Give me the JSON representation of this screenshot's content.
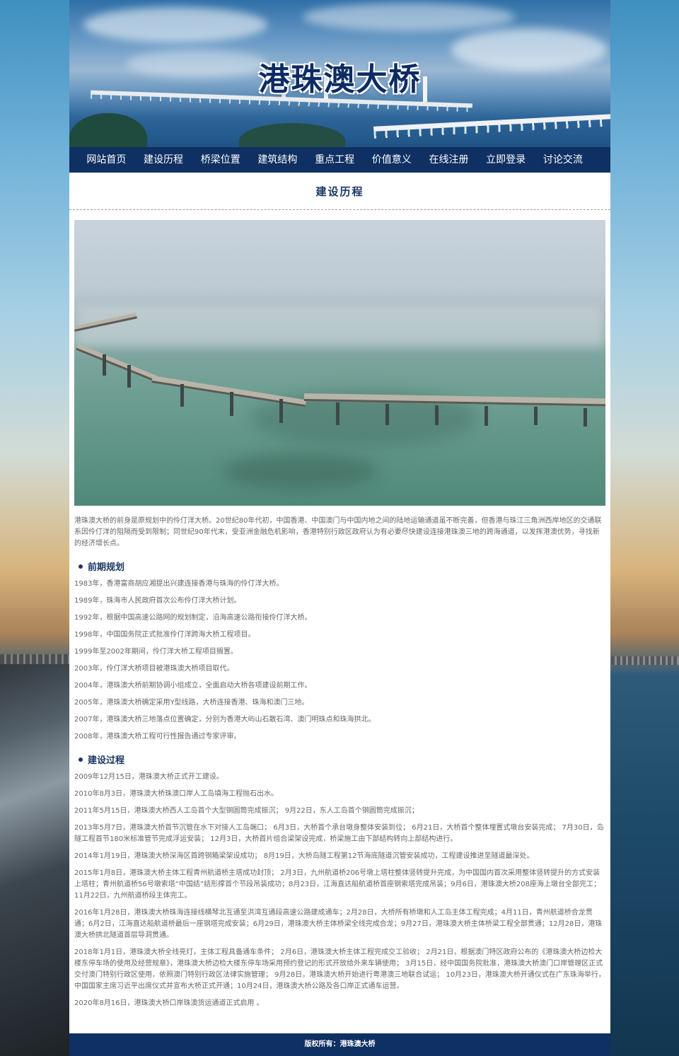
{
  "banner": {
    "title": "港珠澳大桥"
  },
  "nav": {
    "items": [
      "网站首页",
      "建设历程",
      "桥梁位置",
      "建筑结构",
      "重点工程",
      "价值意义",
      "在线注册",
      "立即登录",
      "讨论交流"
    ]
  },
  "section": {
    "title": "建设历程"
  },
  "intro": "港珠澳大桥的前身是原规划中的伶仃洋大桥。20世纪80年代初，中国香港、中国澳门与中国内地之间的陆地运输通道虽不断完善，但香港与珠江三角洲西岸地区的交通联系因伶仃洋的阻隔而受到限制；同世纪90年代末，受亚洲金融危机影响，香港特别行政区政府认为有必要尽快建设连接港珠澳三地的跨海通道，以发挥港澳优势，寻找新的经济增长点。",
  "phases": [
    {
      "heading": "前期规划",
      "events": [
        "1983年，香港富商胡应湘提出兴建连接香港与珠海的伶仃洋大桥。",
        "1989年，珠海市人民政府首次公布伶仃洋大桥计划。",
        "1992年，根据中国高速公路网的规划制定，沿海高速公路衔接伶仃洋大桥。",
        "1998年，中国国务院正式批准伶仃洋跨海大桥工程项目。",
        "1999年至2002年期间，伶仃洋大桥工程项目搁置。",
        "2003年，伶仃洋大桥项目被港珠澳大桥项目取代。",
        "2004年，港珠澳大桥前期协调小组成立，全面启动大桥各项建设前期工作。",
        "2005年，港珠澳大桥确定采用Y型线路，大桥连接香港、珠海和澳门三地。",
        "2007年，港珠澳大桥三地落点位置确定，分别为香港大屿山石散石湾、澳门明珠点和珠海拱北。",
        "2008年，港珠澳大桥工程可行性报告通过专家评审。"
      ]
    },
    {
      "heading": "建设过程",
      "events": [
        "2009年12月15日，港珠澳大桥正式开工建设。",
        "2010年8月3日，港珠澳大桥珠澳口岸人工岛填海工程抛石出水。",
        "2011年5月15日，港珠澳大桥西人工岛首个大型钢圆筒完成振沉； 9月22日，东人工岛首个钢圆筒完成振沉；",
        "2013年5月7日，港珠澳大桥首节沉管在水下对接人工岛端口； 6月3日，大桥首个承台墩身整体安装到位； 6月21日，大桥首个整体埋置式墩台安装完成； 7月30日，岛隧工程首节180米标准管节完成浮运安装； 12月3日，大桥首片组合梁架设完成，桥梁施工由下部结构转向上部结构进行。",
        "2014年1月19日，港珠澳大桥深海区首跨钢箱梁架设成功； 8月19日，大桥岛隧工程第12节海底隧道沉管安装成功，工程建设推进至隧道最深处。",
        "2015年1月8日，港珠澳大桥主体工程青州航道桥主塔成功封顶； 2月3日，九州航道桥206号墩上塔柱整体竖转提升完成，为中国国内首次采用整体竖转提升的方式安装上塔柱；青州航道桥56号墩索塔“中国结”结形撑首个节段吊装成功；8月23日，江海直达船航道桥首座钢索塔完成吊装；9月6日，港珠澳大桥208座海上墩台全部完工；11月22日，九州航道桥段主体完工。",
        "2016年1月28日，港珠澳大桥珠海连接线横琴北互通至洪湾互通段高速公路建成通车；2月28日，大桥所有桥墩和人工岛主体工程完成；4月11日，青州航道桥合龙贯通；6月2日，江海直达船航道桥最后一座钢塔完成安装；6月29日，港珠澳大桥主体桥梁全线完成合龙；9月27日，港珠澳大桥主体桥梁工程全部贯通；12月28日，港珠澳大桥拱北隧道首层导洞贯通。",
        "2018年1月1日，港珠澳大桥全线亮灯，主体工程具备通车条件； 2月6日，港珠澳大桥主体工程完成交工验收； 2月21日，根据澳门特区政府公布的《港珠澳大桥边检大楼东停车场的使用及经营规章》，港珠澳大桥边检大楼东停车场采用预约登记的形式开放给外来车辆使用； 3月15日，经中国国务院批准，港珠澳大桥澳门口岸管理区正式交付澳门特别行政区使用，依照澳门特别行政区法律实施管理； 9月28日，港珠澳大桥开始进行粤港澳三地联合试运； 10月23日，港珠澳大桥开通仪式在广东珠海举行，中国国家主席习近平出席仪式并宣布大桥正式开通；10月24日，港珠澳大桥公路及各口岸正式通车运营。",
        "2020年8月16日，港珠澳大桥口岸珠澳货运通道正式启用 。"
      ]
    }
  ],
  "footer": {
    "text": "版权所有：港珠澳大桥"
  },
  "colors": {
    "nav_bg": "#0f3063",
    "title_text": "#1b3765",
    "body_text": "#666666"
  }
}
